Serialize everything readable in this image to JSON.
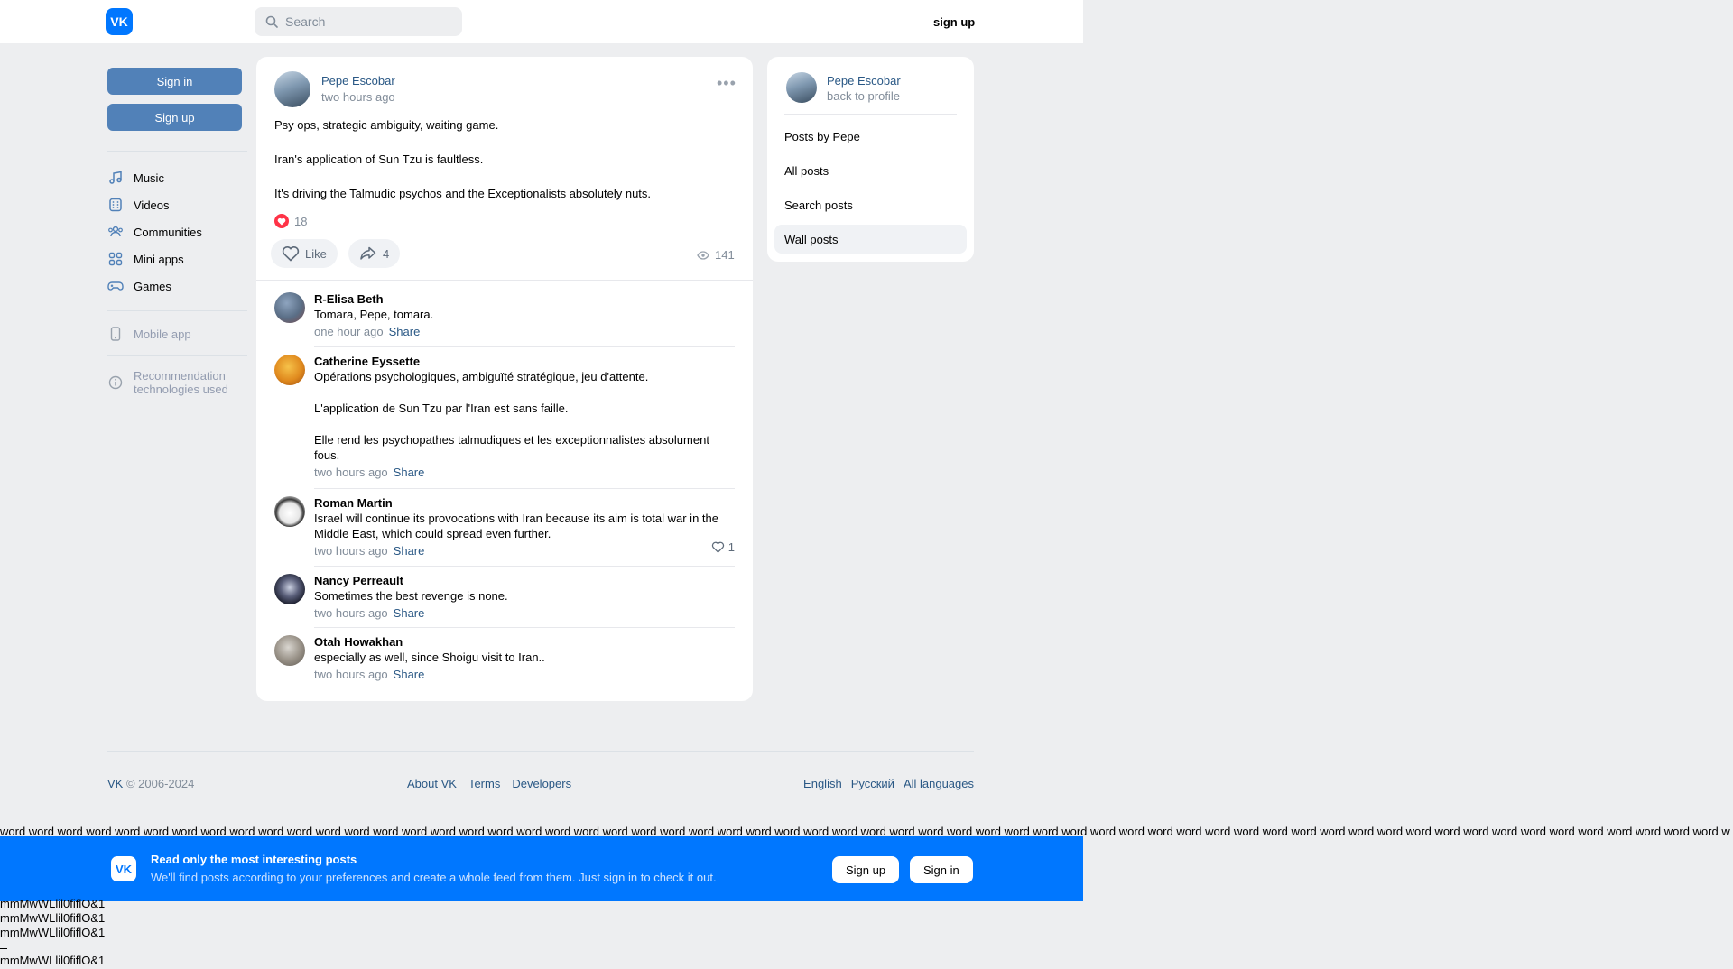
{
  "header": {
    "logo": "VK",
    "search_placeholder": "Search",
    "signup": "sign up"
  },
  "left_nav": {
    "sign_in": "Sign in",
    "sign_up": "Sign up",
    "items": [
      {
        "label": "Music",
        "icon": "music-icon"
      },
      {
        "label": "Videos",
        "icon": "video-icon"
      },
      {
        "label": "Communities",
        "icon": "communities-icon"
      },
      {
        "label": "Mini apps",
        "icon": "apps-icon"
      },
      {
        "label": "Games",
        "icon": "gamepad-icon"
      }
    ],
    "mobile_app": "Mobile app",
    "recommendation_line1": "Recommendation",
    "recommendation_line2": "technologies used"
  },
  "post": {
    "author": "Pepe Escobar",
    "time": "two hours ago",
    "paragraphs": [
      "Psy ops, strategic ambiguity, waiting game.",
      "Iran's application of Sun Tzu is faultless.",
      "It's driving the Talmudic psychos and the Exceptionalists absolutely nuts."
    ],
    "reactions_count": "18",
    "like_label": "Like",
    "share_count": "4",
    "views": "141"
  },
  "comments": [
    {
      "name": "R-Elisa Beth",
      "paragraphs": [
        "Tomara, Pepe, tomara."
      ],
      "time": "one hour ago",
      "share": "Share",
      "likes": ""
    },
    {
      "name": "Catherine Eyssette",
      "paragraphs": [
        "Opérations psychologiques, ambiguïté stratégique, jeu d'attente.",
        "L'application de Sun Tzu par l'Iran est sans faille.",
        "Elle rend les psychopathes talmudiques et les exceptionnalistes absolument fous."
      ],
      "time": "two hours ago",
      "share": "Share",
      "likes": ""
    },
    {
      "name": "Roman Martin",
      "paragraphs": [
        "Israel will continue its provocations with Iran because its aim is total war in the Middle East, which could spread even further."
      ],
      "time": "two hours ago",
      "share": "Share",
      "likes": "1"
    },
    {
      "name": "Nancy Perreault",
      "paragraphs": [
        "Sometimes the best revenge is none."
      ],
      "time": "two hours ago",
      "share": "Share",
      "likes": ""
    },
    {
      "name": "Otah Howakhan",
      "paragraphs": [
        "especially as well, since Shoigu visit to Iran.."
      ],
      "time": "two hours ago",
      "share": "Share",
      "likes": ""
    }
  ],
  "right_card": {
    "name": "Pepe Escobar",
    "back": "back to profile",
    "items": [
      "Posts by Pepe",
      "All posts",
      "Search posts",
      "Wall posts"
    ]
  },
  "footer": {
    "copy_vk": "VK",
    "copy_rest": " © 2006-2024",
    "links": [
      "About VK",
      "Terms",
      "Developers"
    ],
    "langs": [
      "English",
      "Русский",
      "All languages"
    ]
  },
  "filler_words": "word word word word word word word word word word word word word word word word word word word word word word word word word word word word word word word word word word word word word word word word word word word word word word word word word word word word word word word word word word word word word word word word word word word word word word word word word word word word word word word word word word word word word word word word word word word word word word word word",
  "banner": {
    "title": "Read only the most interesting posts",
    "subtitle": "We'll find posts according to your preferences and create a whole feed from them. Just sign in to check it out.",
    "sign_up": "Sign up",
    "sign_in": "Sign in"
  },
  "test_strings": [
    "mmMwWLlil0fiflO&1",
    "mmMwWLlil0fiflO&1",
    "mmMwWLlil0fiflO&1",
    "mmMwWLlil0fiflO&1"
  ],
  "colors": {
    "accent": "#0077ff",
    "button_blue": "#5181b8",
    "link": "#2a5885",
    "muted": "#818c99",
    "background": "#edeef0",
    "reaction_red": "#ff3347"
  }
}
